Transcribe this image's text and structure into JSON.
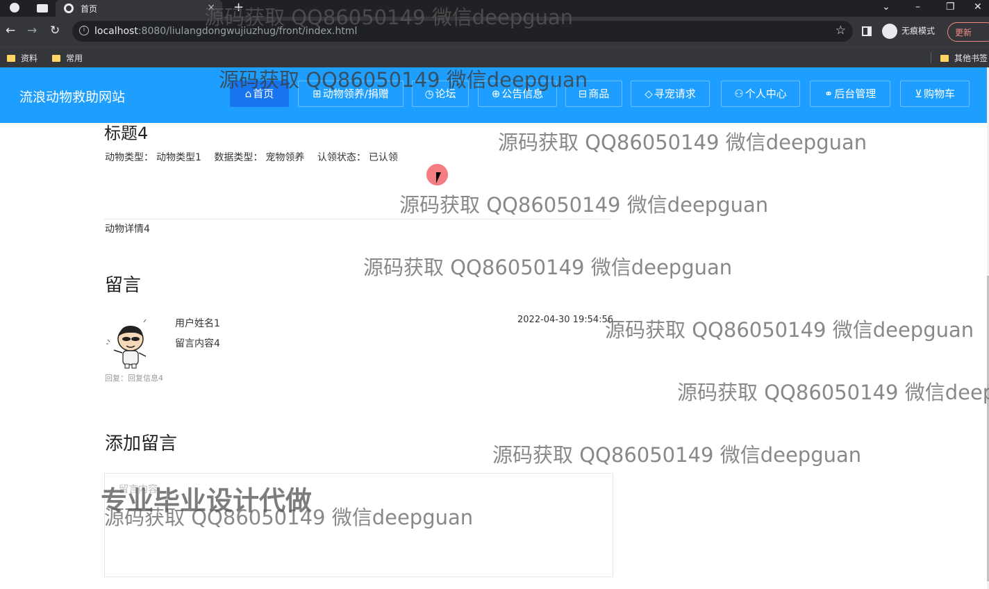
{
  "browser": {
    "tab_title": "首页",
    "tab_close": "×",
    "new_tab": "+",
    "url_host": "localhost",
    "url_rest": ":8080/liulangdongwujiuzhug/front/index.html",
    "incognito_label": "无痕模式",
    "update_label": "更新",
    "bookmarks": [
      "资料",
      "常用"
    ],
    "other_bookmarks": "其他书签"
  },
  "site": {
    "logo": "流浪动物救助网站",
    "nav": [
      {
        "icon": "⌂",
        "label": "首页"
      },
      {
        "icon": "⊞",
        "label": "动物领养/捐赠"
      },
      {
        "icon": "◷",
        "label": "论坛"
      },
      {
        "icon": "⊕",
        "label": "公告信息"
      },
      {
        "icon": "⊟",
        "label": "商品"
      },
      {
        "icon": "◇",
        "label": "寻宠请求"
      },
      {
        "icon": "⚇",
        "label": "个人中心"
      },
      {
        "icon": "⚭",
        "label": "后台管理"
      },
      {
        "icon": "⊻",
        "label": "购物车"
      }
    ]
  },
  "detail": {
    "title": "标题4",
    "animal_type_label": "动物类型：",
    "animal_type": "动物类型1",
    "data_type_label": "数据类型：",
    "data_type": "宠物领养",
    "status_label": "认领状态：",
    "status": "已认领",
    "body": "动物详情4"
  },
  "comments": {
    "section_title": "留言",
    "items": [
      {
        "user": "用户姓名1",
        "content": "留言内容4",
        "time": "2022-04-30 19:54:56",
        "reply": "回复：回复信息4"
      }
    ]
  },
  "add_comment": {
    "section_title": "添加留言",
    "placeholder": "留言内容"
  },
  "overlay": {
    "watermark": "源码获取 QQ86050149 微信deepguan",
    "watermark_cut": "源码获取 QQ86050149 微信deep",
    "promo": "专业毕业设计代做"
  },
  "colors": {
    "header": "#1e9fff",
    "nav_active": "#1875f0"
  }
}
